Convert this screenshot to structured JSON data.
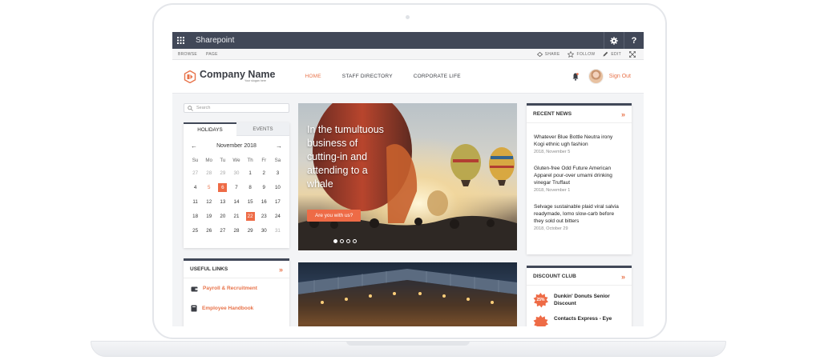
{
  "suitebar": {
    "title": "Sharepoint",
    "settings_icon": "gear-icon",
    "help_label": "?"
  },
  "ribbon": {
    "tabs": [
      "BROWSE",
      "PAGE"
    ],
    "actions": {
      "share": "SHARE",
      "follow": "FOLLOW",
      "edit": "EDIT"
    }
  },
  "header": {
    "company_name": "Company Name",
    "slogan": "Your slogan here",
    "nav": [
      "HOME",
      "STAFF DIRECTORY",
      "CORPORATE LIFE"
    ],
    "sign_out": "Sign Out"
  },
  "search": {
    "placeholder": "Search"
  },
  "calendar": {
    "tabs": [
      "HOLIDAYS",
      "EVENTS"
    ],
    "month": "November 2018",
    "prev": "←",
    "next": "→",
    "days_of_week": [
      "Su",
      "Mo",
      "Tu",
      "We",
      "Th",
      "Fr",
      "Sa"
    ],
    "weeks": [
      [
        "27",
        "28",
        "29",
        "30",
        "1",
        "2",
        "3"
      ],
      [
        "4",
        "5",
        "6",
        "7",
        "8",
        "9",
        "10"
      ],
      [
        "11",
        "12",
        "13",
        "14",
        "15",
        "16",
        "17"
      ],
      [
        "18",
        "19",
        "20",
        "21",
        "22",
        "23",
        "24"
      ],
      [
        "25",
        "26",
        "27",
        "28",
        "29",
        "30",
        "31"
      ]
    ]
  },
  "useful_links": {
    "title": "USEFUL LINKS",
    "items": [
      "Payroll & Recruitment",
      "Employee Handbook"
    ]
  },
  "hero": {
    "text": "In the tumultuous business of cutting-in and attending to a whale",
    "button": "Are you with us?"
  },
  "recent_news": {
    "title": "RECENT NEWS",
    "items": [
      {
        "title": "Whatever Blue Bottle Neutra irony Kogi ethnic ugh fashion",
        "date": "2018, November 5"
      },
      {
        "title": "Gluten-free Odd Future American Apparel pour-over umami drinking vinegar Truffaut",
        "date": "2018, November 1"
      },
      {
        "title": "Selvage sustainable plaid viral salvia readymade, lomo slow-carb before they sold out bitters",
        "date": "2018, October 29"
      }
    ]
  },
  "discount_club": {
    "title": "DISCOUNT CLUB",
    "items": [
      {
        "badge": "25%",
        "title": "Dunkin' Donuts Senior Discount"
      },
      {
        "badge": "",
        "title": "Contacts Express - Eye"
      }
    ]
  },
  "colors": {
    "accent": "#ee6b46",
    "suitebar": "#414858"
  }
}
